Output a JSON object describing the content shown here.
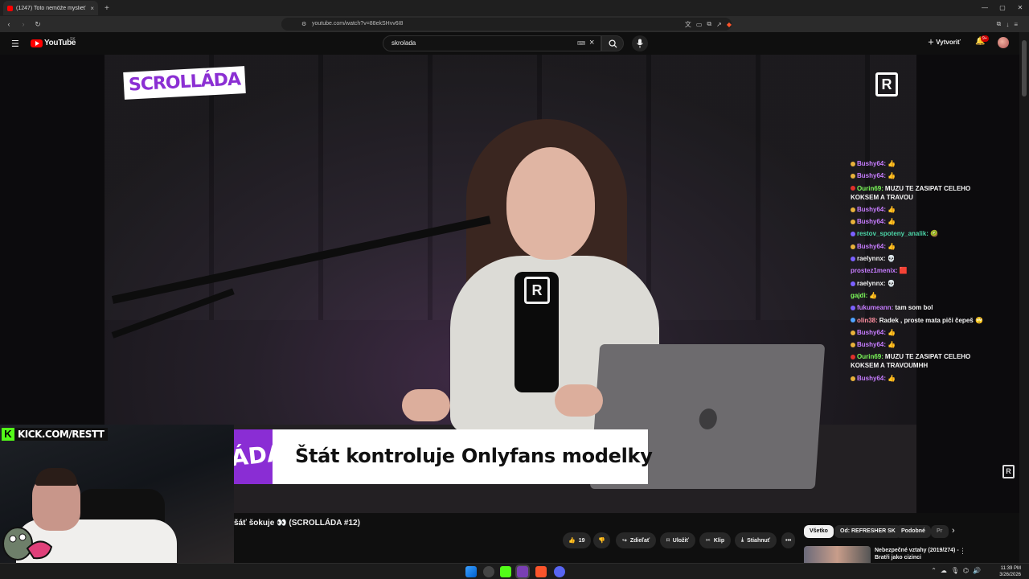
{
  "browser": {
    "tab_title": "(1247) Toto nemôže myslieť v...",
    "url": "youtube.com/watch?v=88ekSHvv6I8",
    "new_tab": "+",
    "close": "×",
    "window_controls": [
      "—",
      "▢",
      "✕"
    ]
  },
  "youtube": {
    "logo_text": "YouTube",
    "country": "SK",
    "search_value": "skrolada",
    "create_label": "Vytvoriť",
    "notif_count": "9+"
  },
  "video": {
    "brand_logo": "SCROLLÁDA",
    "corner_logo": "R",
    "mic_logo": "R",
    "lower_third_brand": "ÁDA",
    "lower_third_title": "Štát kontroluje Onlyfans modelky",
    "kick_label": "KICK.COM/RESTT",
    "kick_k": "K"
  },
  "chat": [
    {
      "user": "Bushy64:",
      "text": "👍",
      "color": "#c77dff",
      "badge": "#e8b13a"
    },
    {
      "user": "Bushy64:",
      "text": "👍",
      "color": "#c77dff",
      "badge": "#e8b13a"
    },
    {
      "user": "Ourin69:",
      "text": "MUZU TE ZASIPAT CELEHO KOKSEM A TRAVOU",
      "color": "#7cfc5a",
      "badge": "#e0302b"
    },
    {
      "user": "Bushy64:",
      "text": "👍",
      "color": "#c77dff",
      "badge": "#e8b13a"
    },
    {
      "user": "Bushy64:",
      "text": "👍",
      "color": "#c77dff",
      "badge": "#e8b13a"
    },
    {
      "user": "restov_spoteny_analik:",
      "text": "🥝",
      "color": "#4cd6a8",
      "badge": "#7b61ff"
    },
    {
      "user": "Bushy64:",
      "text": "👍",
      "color": "#c77dff",
      "badge": "#e8b13a"
    },
    {
      "user": "raelynnx:",
      "text": "💀",
      "color": "#f1f1f1",
      "badge": "#7b61ff"
    },
    {
      "user": "prostez1menix:",
      "text": "🟥",
      "color": "#c77dff",
      "badge": ""
    },
    {
      "user": "raelynnx:",
      "text": "💀",
      "color": "#f1f1f1",
      "badge": "#7b61ff"
    },
    {
      "user": "gajdi:",
      "text": "👍",
      "color": "#7cfc5a",
      "badge": ""
    },
    {
      "user": "fukumeann:",
      "text": "tam som bol",
      "color": "#c77dff",
      "badge": "#7b61ff"
    },
    {
      "user": "olin38:",
      "text": "Radek , proste mata piči čepeš 🙄",
      "color": "#ff8fa0",
      "badge": "#4fa3ff"
    },
    {
      "user": "Bushy64:",
      "text": "👍",
      "color": "#c77dff",
      "badge": "#e8b13a"
    },
    {
      "user": "Bushy64:",
      "text": "👍",
      "color": "#c77dff",
      "badge": "#e8b13a"
    },
    {
      "user": "Ourin69:",
      "text": "MUZU TE ZASIPAT CELEHO KOKSEM A TRAVOUMHH",
      "color": "#7cfc5a",
      "badge": "#e0302b"
    },
    {
      "user": "Bushy64:",
      "text": "👍",
      "color": "#c77dff",
      "badge": "#e8b13a"
    }
  ],
  "below_video": {
    "title": "šáť šokuje 👀 (SCROLLÁDA #12)",
    "like_count": "19",
    "share_label": "Zdieľať",
    "save_label": "Uložiť",
    "clip_label": "Klip",
    "download_label": "Stiahnuť",
    "more_label": "•••",
    "chips": [
      "Všetko",
      "Od: REFRESHER SK",
      "Podobné",
      "Pr"
    ],
    "chips_next": "›",
    "rec_title": "Nebezpečné vztahy (2019/274) - Bratři jako cizinci"
  },
  "taskbar": {
    "time": "11:39 PM",
    "date": "3/26/2026"
  }
}
